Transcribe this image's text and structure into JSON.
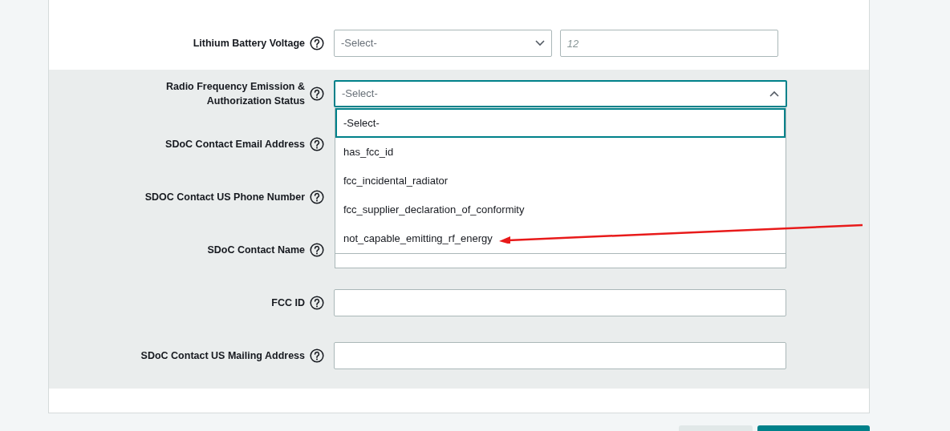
{
  "sections": [
    {
      "shaded": false,
      "fields": [
        {
          "kind": "select_pair",
          "label": "Lithium Battery Voltage",
          "select": {
            "value": "-Select-",
            "expanded": false
          },
          "input": {
            "placeholder": "12"
          }
        }
      ]
    },
    {
      "shaded": true,
      "fields": [
        {
          "kind": "dropdown",
          "label": "Radio Frequency Emission & Authorization Status",
          "select": {
            "value": "-Select-",
            "expanded": true,
            "options": [
              {
                "label": "-Select-",
                "selected": true
              },
              {
                "label": "has_fcc_id",
                "selected": false
              },
              {
                "label": "fcc_incidental_radiator",
                "selected": false
              },
              {
                "label": "fcc_supplier_declaration_of_conformity",
                "selected": false
              },
              {
                "label": "not_capable_emitting_rf_energy",
                "selected": false
              }
            ]
          }
        },
        {
          "kind": "covered",
          "label": "SDoC Contact Email Address"
        },
        {
          "kind": "covered",
          "label": "SDOC Contact US Phone Number"
        },
        {
          "kind": "covered",
          "label": "SDoC Contact Name"
        },
        {
          "kind": "text",
          "label": "FCC ID"
        },
        {
          "kind": "text",
          "label": "SDoC Contact US Mailing Address"
        }
      ]
    }
  ],
  "footer_buttons": [
    {
      "kind": "secondary"
    },
    {
      "kind": "primary"
    }
  ]
}
